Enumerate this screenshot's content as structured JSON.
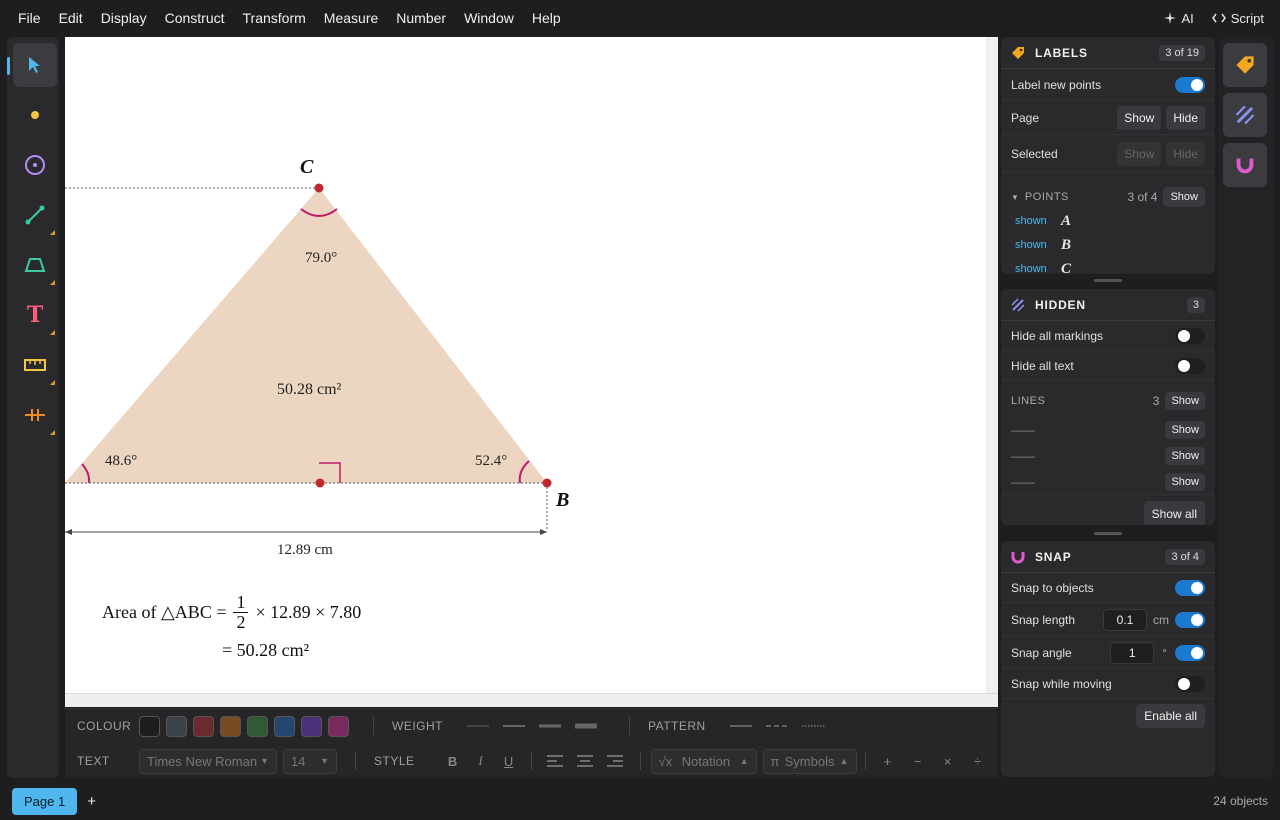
{
  "menu": {
    "items": [
      "File",
      "Edit",
      "Display",
      "Construct",
      "Transform",
      "Measure",
      "Number",
      "Window",
      "Help"
    ],
    "ai_label": "AI",
    "script_label": "Script"
  },
  "tools": [
    {
      "name": "select-arrow-tool",
      "icon": "arrow-cursor-icon",
      "color": "#4fb6ee"
    },
    {
      "name": "point-tool",
      "icon": "point-icon",
      "color": "#f5c542"
    },
    {
      "name": "circle-tool",
      "icon": "circle-icon",
      "color": "#b48cf2"
    },
    {
      "name": "segment-tool",
      "icon": "segment-icon",
      "color": "#3cc9a0"
    },
    {
      "name": "polygon-tool",
      "icon": "polygon-icon",
      "color": "#3cc9a0"
    },
    {
      "name": "text-tool",
      "icon": "text-T-icon",
      "color": "#ff5c7a"
    },
    {
      "name": "measure-tool",
      "icon": "ruler-icon",
      "color": "#f5c542"
    },
    {
      "name": "marker-tool",
      "icon": "marker-icon",
      "color": "#f08a24"
    }
  ],
  "canvas": {
    "labels": {
      "A": "",
      "B": "B",
      "C": "C"
    },
    "angle_c": "79.0°",
    "angle_a": "48.6°",
    "angle_b": "52.4°",
    "area": "50.28 cm²",
    "base_length": "12.89 cm",
    "formula_prefix": "Area of △ABC =",
    "formula_num": "1",
    "formula_den": "2",
    "formula_rest": "× 12.89 × 7.80",
    "formula_result": "= 50.28 cm²",
    "fill_color": "#ecd6c1",
    "point_color": "#c0262d",
    "arc_color": "#c0186e"
  },
  "props": {
    "colour_label": "COLOUR",
    "swatches": [
      "#1e1e20",
      "#3d4148",
      "#6b2a2e",
      "#7a4a22",
      "#2e5a36",
      "#25466e",
      "#4a327a",
      "#7a2a5c"
    ],
    "weight_label": "WEIGHT",
    "pattern_label": "PATTERN",
    "text_label": "TEXT",
    "font_value": "Times New Roman",
    "size_value": "14",
    "style_label": "STYLE",
    "bold": "B",
    "italic": "I",
    "underline": "U",
    "notation_label": "Notation",
    "symbols_label": "Symbols",
    "ops": [
      "+",
      "−",
      "×",
      "÷"
    ]
  },
  "labels_panel": {
    "title": "LABELS",
    "count": "3 of 19",
    "label_new_points": "Label new points",
    "page": "Page",
    "selected": "Selected",
    "show": "Show",
    "hide": "Hide",
    "points_header": "POINTS",
    "points_count": "3 of 4",
    "points": [
      {
        "state": "shown",
        "name": "A"
      },
      {
        "state": "shown",
        "name": "B"
      },
      {
        "state": "shown",
        "name": "C"
      }
    ]
  },
  "hidden_panel": {
    "title": "HIDDEN",
    "count": "3",
    "hide_markings": "Hide all markings",
    "hide_text": "Hide all text",
    "lines_header": "LINES",
    "lines_count": "3",
    "show": "Show",
    "show_all": "Show all"
  },
  "snap_panel": {
    "title": "SNAP",
    "count": "3 of 4",
    "snap_objects": "Snap to objects",
    "snap_length": "Snap length",
    "snap_length_value": "0.1",
    "snap_length_unit": "cm",
    "snap_angle": "Snap angle",
    "snap_angle_value": "1",
    "snap_angle_unit": "°",
    "snap_moving": "Snap while moving",
    "enable_all": "Enable all"
  },
  "status": {
    "page_tab": "Page 1",
    "add": "+",
    "objects": "24 objects"
  }
}
